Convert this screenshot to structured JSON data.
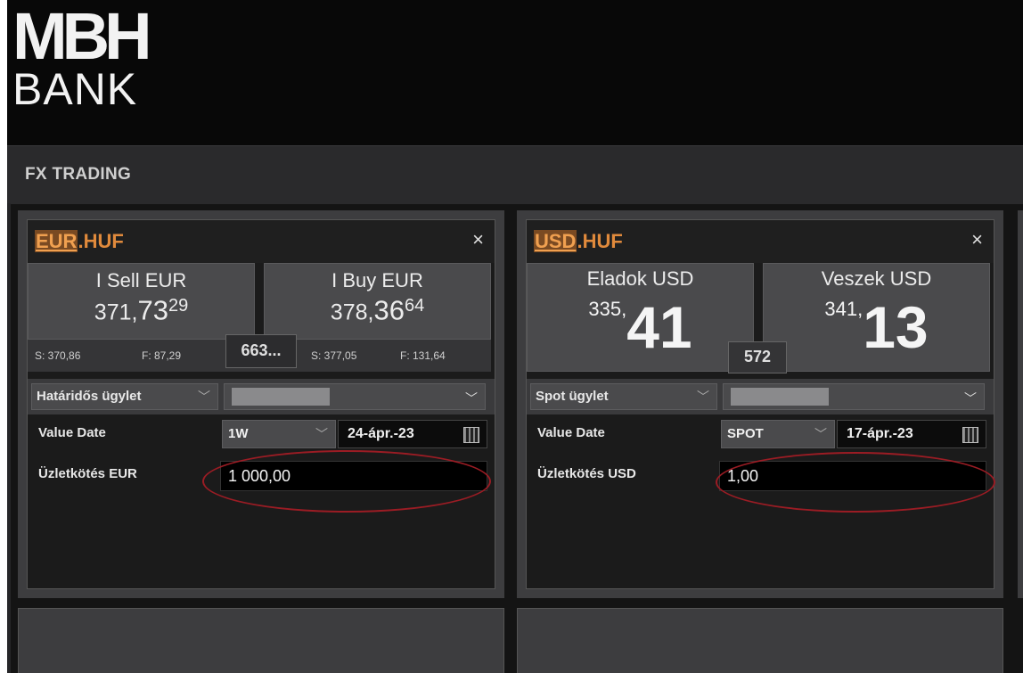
{
  "header": {
    "logo_mark": "MBH",
    "logo_word": "BANK"
  },
  "titlebar": {
    "title": "FX TRADING"
  },
  "tiles": [
    {
      "pair_base": "EUR",
      "pair_quote": ".HUF",
      "close": "×",
      "sell": {
        "label": "I Sell EUR",
        "lead": "371,",
        "big": "73",
        "pip": "29"
      },
      "buy": {
        "label": "I Buy EUR",
        "lead": "378,",
        "big": "36",
        "pip": "64"
      },
      "sell_sub": {
        "s": "S: 370,86",
        "f": "F: 87,29"
      },
      "buy_sub": {
        "s": "S: 377,05",
        "f": "F: 131,64"
      },
      "spread": "663...",
      "deal_type": "Határidős ügylet",
      "value_date_label": "Value Date",
      "tenor": "1W",
      "date": "24-ápr.-23",
      "amount_label": "Üzletkötés EUR",
      "amount": "1 000,00"
    },
    {
      "pair_base": "USD",
      "pair_quote": ".HUF",
      "close": "×",
      "sell": {
        "label": "Eladok USD",
        "lead": "335,",
        "big": "41"
      },
      "buy": {
        "label": "Veszek USD",
        "lead": "341,",
        "big": "13"
      },
      "spread": "572",
      "deal_type": "Spot ügylet",
      "value_date_label": "Value Date",
      "tenor": "SPOT",
      "date": "17-ápr.-23",
      "amount_label": "Üzletkötés USD",
      "amount": "1,00"
    }
  ],
  "colors": {
    "accent": "#e08a3c",
    "highlight_ring": "#9b1c24"
  },
  "icons": [
    "close-icon",
    "chevron-down-icon",
    "calendar-icon"
  ]
}
